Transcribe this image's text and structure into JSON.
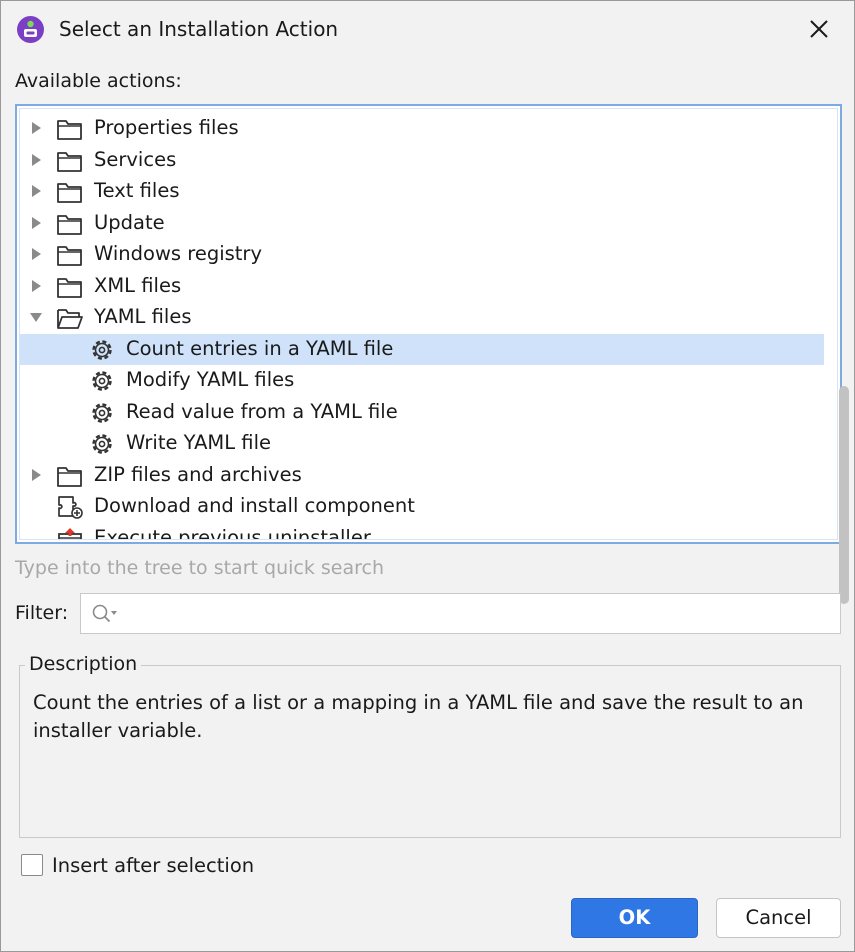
{
  "window": {
    "title": "Select an Installation Action",
    "app_icon": "installer-icon",
    "close_icon": "close-icon"
  },
  "tree": {
    "label": "Available actions:",
    "rows": [
      {
        "label": "Properties files",
        "type": "folder",
        "expanded": false
      },
      {
        "label": "Services",
        "type": "folder",
        "expanded": false
      },
      {
        "label": "Text files",
        "type": "folder",
        "expanded": false
      },
      {
        "label": "Update",
        "type": "folder",
        "expanded": false
      },
      {
        "label": "Windows registry",
        "type": "folder",
        "expanded": false
      },
      {
        "label": "XML files",
        "type": "folder",
        "expanded": false
      },
      {
        "label": "YAML files",
        "type": "folder",
        "expanded": true
      },
      {
        "label": "Count entries in a YAML file",
        "type": "action",
        "selected": true
      },
      {
        "label": "Modify YAML files",
        "type": "action"
      },
      {
        "label": "Read value from a YAML file",
        "type": "action"
      },
      {
        "label": "Write YAML file",
        "type": "action"
      },
      {
        "label": "ZIP files and archives",
        "type": "folder",
        "expanded": false
      },
      {
        "label": "Download and install component",
        "type": "download-action"
      },
      {
        "label": "Execute previous uninstaller",
        "type": "uninstall-action"
      }
    ],
    "hint": "Type into the tree to start quick search"
  },
  "filter": {
    "label": "Filter:",
    "value": "",
    "icon": "search-icon"
  },
  "description": {
    "legend": "Description",
    "text": "Count the entries of a list or a mapping in a YAML file and save the result to an installer variable."
  },
  "options": {
    "insert_after_selection": "Insert after selection",
    "insert_after_checked": false
  },
  "buttons": {
    "ok": "OK",
    "cancel": "Cancel"
  },
  "colors": {
    "accent": "#2f77e4",
    "selection": "#cfe2fa",
    "focus_border": "#7fa9e3"
  }
}
